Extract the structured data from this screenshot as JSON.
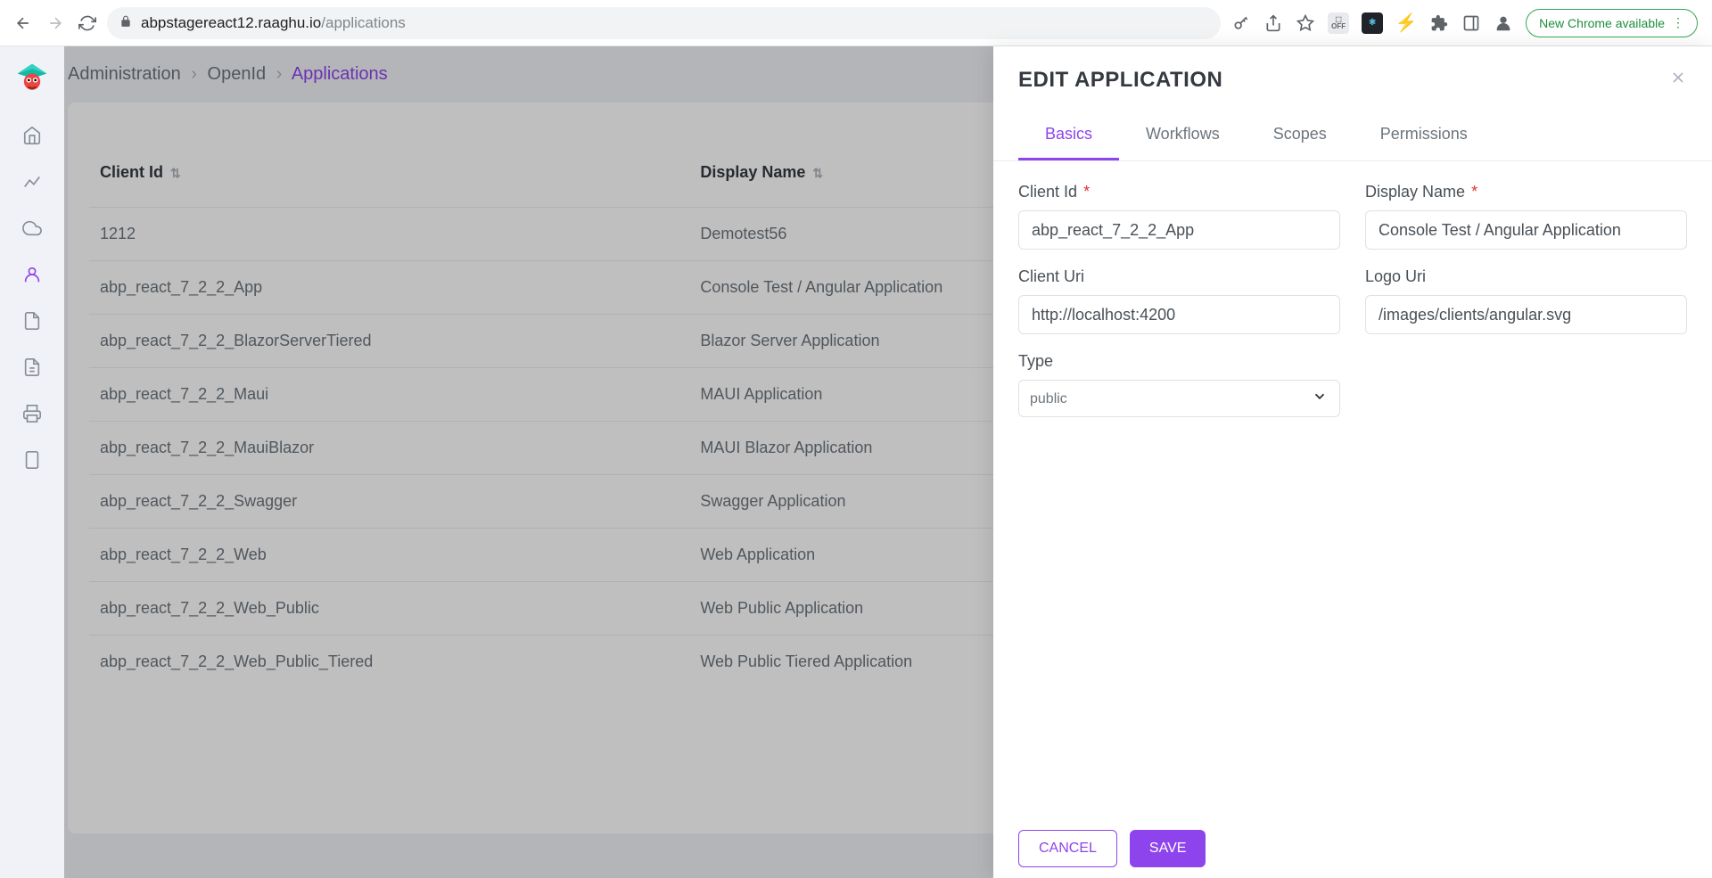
{
  "browser": {
    "url_host": "abpstagereact12.raaghu.io",
    "url_path": "/applications",
    "update_label": "New Chrome available"
  },
  "breadcrumb": {
    "item1": "Administration",
    "item2": "OpenId",
    "current": "Applications"
  },
  "table": {
    "headers": {
      "client_id": "Client Id",
      "display_name": "Display Name"
    },
    "rows": [
      {
        "client_id": "1212",
        "display_name": "Demotest56"
      },
      {
        "client_id": "abp_react_7_2_2_App",
        "display_name": "Console Test / Angular Application"
      },
      {
        "client_id": "abp_react_7_2_2_BlazorServerTiered",
        "display_name": "Blazor Server Application"
      },
      {
        "client_id": "abp_react_7_2_2_Maui",
        "display_name": "MAUI Application"
      },
      {
        "client_id": "abp_react_7_2_2_MauiBlazor",
        "display_name": "MAUI Blazor Application"
      },
      {
        "client_id": "abp_react_7_2_2_Swagger",
        "display_name": "Swagger Application"
      },
      {
        "client_id": "abp_react_7_2_2_Web",
        "display_name": "Web Application"
      },
      {
        "client_id": "abp_react_7_2_2_Web_Public",
        "display_name": "Web Public Application"
      },
      {
        "client_id": "abp_react_7_2_2_Web_Public_Tiered",
        "display_name": "Web Public Tiered Application"
      }
    ]
  },
  "panel": {
    "title": "EDIT APPLICATION",
    "tabs": {
      "basics": "Basics",
      "workflows": "Workflows",
      "scopes": "Scopes",
      "permissions": "Permissions"
    },
    "labels": {
      "client_id": "Client Id",
      "display_name": "Display Name",
      "client_uri": "Client Uri",
      "logo_uri": "Logo Uri",
      "type": "Type"
    },
    "values": {
      "client_id": "abp_react_7_2_2_App",
      "display_name": "Console Test / Angular Application",
      "client_uri": "http://localhost:4200",
      "logo_uri": "/images/clients/angular.svg",
      "type": "public"
    },
    "buttons": {
      "cancel": "CANCEL",
      "save": "SAVE"
    }
  }
}
